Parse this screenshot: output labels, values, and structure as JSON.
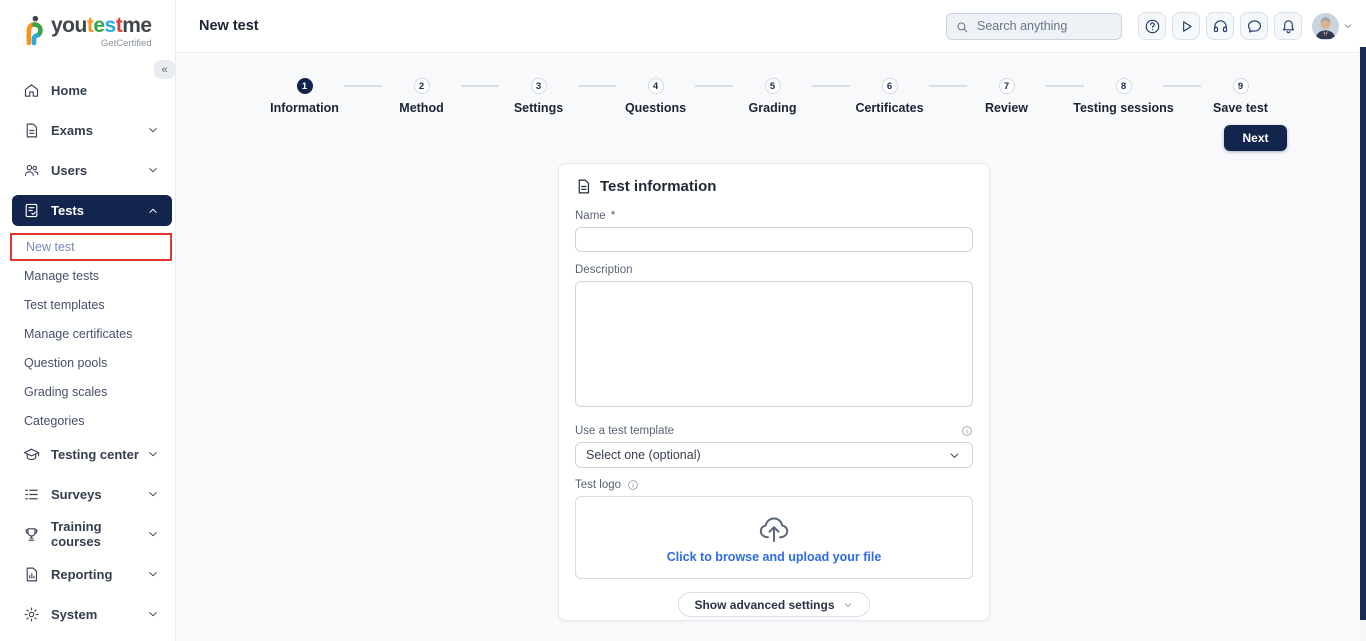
{
  "brand": {
    "logo_segments": [
      {
        "text": "you",
        "color": "#41454c"
      },
      {
        "text": "t",
        "color": "#f6921e"
      },
      {
        "text": "e",
        "color": "#37a34a"
      },
      {
        "text": "s",
        "color": "#27aae1"
      },
      {
        "text": "t",
        "color": "#e23d33"
      },
      {
        "text": "me",
        "color": "#41454c"
      }
    ],
    "tagline": "GetCertified",
    "collapse_glyph": "«"
  },
  "sidebar": {
    "items": [
      {
        "label": "Home",
        "icon": "home-icon",
        "expandable": false
      },
      {
        "label": "Exams",
        "icon": "exam-icon",
        "expandable": true
      },
      {
        "label": "Users",
        "icon": "users-icon",
        "expandable": true
      },
      {
        "label": "Tests",
        "icon": "tests-icon",
        "expandable": true,
        "active": true,
        "expanded": true
      },
      {
        "label": "Testing center",
        "icon": "testing-center-icon",
        "expandable": true
      },
      {
        "label": "Surveys",
        "icon": "surveys-icon",
        "expandable": true
      },
      {
        "label": "Training courses",
        "icon": "training-courses-icon",
        "expandable": true
      },
      {
        "label": "Reporting",
        "icon": "reporting-icon",
        "expandable": true
      },
      {
        "label": "System",
        "icon": "system-icon",
        "expandable": true
      }
    ],
    "tests_submenu": [
      {
        "label": "New test",
        "active": true,
        "highlighted": true
      },
      {
        "label": "Manage tests"
      },
      {
        "label": "Test templates"
      },
      {
        "label": "Manage certificates"
      },
      {
        "label": "Question pools"
      },
      {
        "label": "Grading scales"
      },
      {
        "label": "Categories"
      }
    ]
  },
  "header": {
    "title": "New test",
    "search": {
      "placeholder": "Search anything",
      "value": ""
    },
    "icon_buttons": [
      {
        "name": "help-icon"
      },
      {
        "name": "play-icon"
      },
      {
        "name": "headphones-icon"
      },
      {
        "name": "chat-icon"
      },
      {
        "name": "notifications-icon"
      }
    ]
  },
  "stepper": {
    "active_step": 1,
    "next_label": "Next",
    "steps": [
      {
        "number": "1",
        "label": "Information"
      },
      {
        "number": "2",
        "label": "Method"
      },
      {
        "number": "3",
        "label": "Settings"
      },
      {
        "number": "4",
        "label": "Questions"
      },
      {
        "number": "5",
        "label": "Grading"
      },
      {
        "number": "6",
        "label": "Certificates"
      },
      {
        "number": "7",
        "label": "Review"
      },
      {
        "number": "8",
        "label": "Testing sessions"
      },
      {
        "number": "9",
        "label": "Save test"
      }
    ]
  },
  "form": {
    "title": "Test information",
    "fields": {
      "name": {
        "label": "Name",
        "required_marker": "*",
        "value": ""
      },
      "description": {
        "label": "Description",
        "value": ""
      },
      "template": {
        "label": "Use a test template",
        "selected": "Select one (optional)"
      },
      "logo": {
        "label": "Test logo",
        "upload_text": "Click to browse and upload your file"
      }
    },
    "advanced_button": "Show advanced settings"
  },
  "colors": {
    "primary_navy": "#13254d",
    "highlight_red": "#e0362c",
    "link_blue": "#2d6ce5",
    "active_subitem_text": "#7c89b8",
    "content_background": "#f8f9fb"
  }
}
